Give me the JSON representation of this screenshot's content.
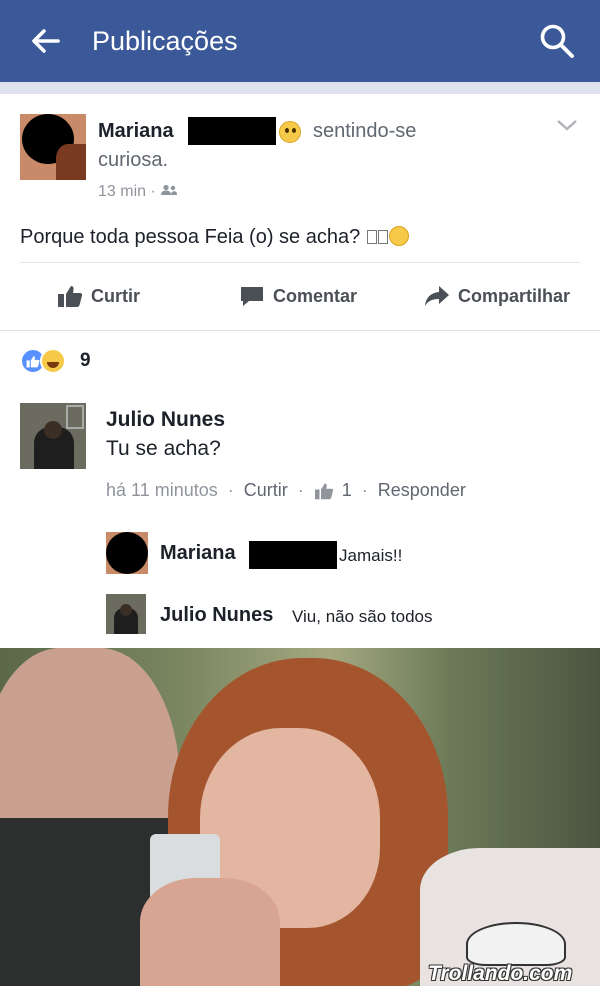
{
  "header": {
    "title": "Publicações",
    "back_icon": "arrow-left-icon",
    "search_icon": "search-icon",
    "bg_color": "#3b5998"
  },
  "post": {
    "author": "Mariana",
    "feeling_prefix": "sentindo-se",
    "feeling": "curiosa.",
    "time": "13 min",
    "audience_icon": "friends-icon",
    "text": "Porque toda pessoa Feia (o) se acha?",
    "actions": {
      "like": "Curtir",
      "comment": "Comentar",
      "share": "Compartilhar"
    }
  },
  "reactions": {
    "icons": [
      "like-reaction-icon",
      "haha-reaction-icon"
    ],
    "count": "9"
  },
  "comment": {
    "author": "Julio Nunes",
    "text": "Tu se acha?",
    "time": "há 11 minutos",
    "like": "Curtir",
    "like_count": "1",
    "reply": "Responder"
  },
  "replies": [
    {
      "author": "Mariana",
      "text": "Jamais!!"
    },
    {
      "author": "Julio Nunes",
      "text": "Viu, não são todos"
    }
  ],
  "photo": {
    "watermark": "Trollando.com"
  }
}
